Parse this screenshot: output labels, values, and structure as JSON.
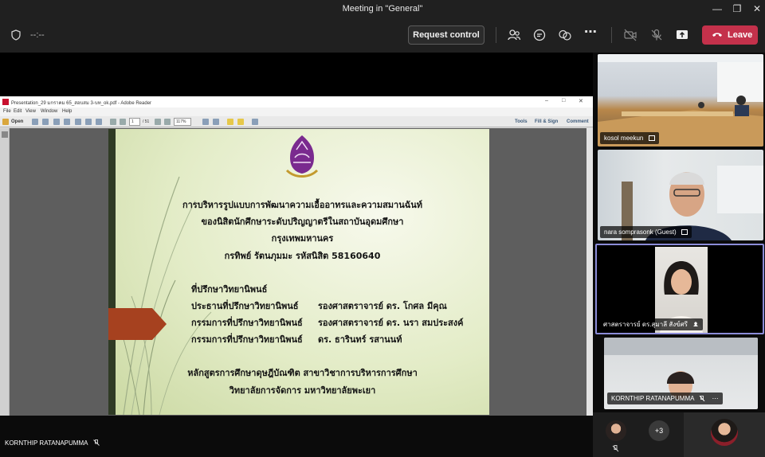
{
  "window": {
    "title": "Meeting in \"General\""
  },
  "toolbar": {
    "timer": "--:--",
    "request_control": "Request control",
    "leave": "Leave"
  },
  "reader": {
    "title": "Presentation_29 มกราคม 65_สอบสม 3-บท_ok.pdf - Adobe Reader",
    "menu": [
      "File",
      "Edit",
      "View",
      "Window",
      "Help"
    ],
    "open": "Open",
    "page": "1",
    "pages": "/ 51",
    "zoom": "117%",
    "tools": "Tools",
    "fill_sign": "Fill & Sign",
    "comment": "Comment"
  },
  "slide": {
    "title_line1": "การบริหารรูปแบบการพัฒนาความเอื้ออาทรและความสมานฉันท์",
    "title_line2": "ของนิสิตนักศึกษาระดับปริญญาตรีในสถาบันอุดมศึกษา",
    "title_line3": "กรุงเทพมหานคร",
    "author": "กรทิพย์ รัตนภุมมะ  รหัสนิสิต 58160640",
    "advisors_header": "ที่ปรึกษาวิทยานิพนธ์",
    "advisors": [
      {
        "role": "ประธานที่ปรึกษาวิทยานิพนธ์",
        "name": "รองศาสตราจารย์ ดร. โกศล มีคุณ"
      },
      {
        "role": "กรรมการที่ปรึกษาวิทยานิพนธ์",
        "name": "รองศาสตราจารย์ ดร. นรา สมประสงค์"
      },
      {
        "role": "กรรมการที่ปรึกษาวิทยานิพนธ์",
        "name": "ดร. ธารินทร์ รสานนท์"
      }
    ],
    "program_line1": "หลักสูตรการศึกษาดุษฎีบัณฑิต สาขาวิชาการบริหารการศึกษา",
    "program_line2": "วิทยาลัยการจัดการ มหาวิทยาลัยพะเยา"
  },
  "participants": [
    {
      "name": "kosol meekun"
    },
    {
      "name": "nara somprasonk (Guest)"
    },
    {
      "name": "ศาสตราจารย์ ดร.สุมาลี สังข์ศรี"
    },
    {
      "name": "KORNTHIP RATANAPUMMA"
    }
  ],
  "overflow": {
    "count": "+3"
  },
  "presenter": {
    "name": "KORNTHIP RATANAPUMMA"
  },
  "colors": {
    "leave": "#c4314b",
    "active_border": "#8b8cd8",
    "toolbar": "#202020"
  }
}
